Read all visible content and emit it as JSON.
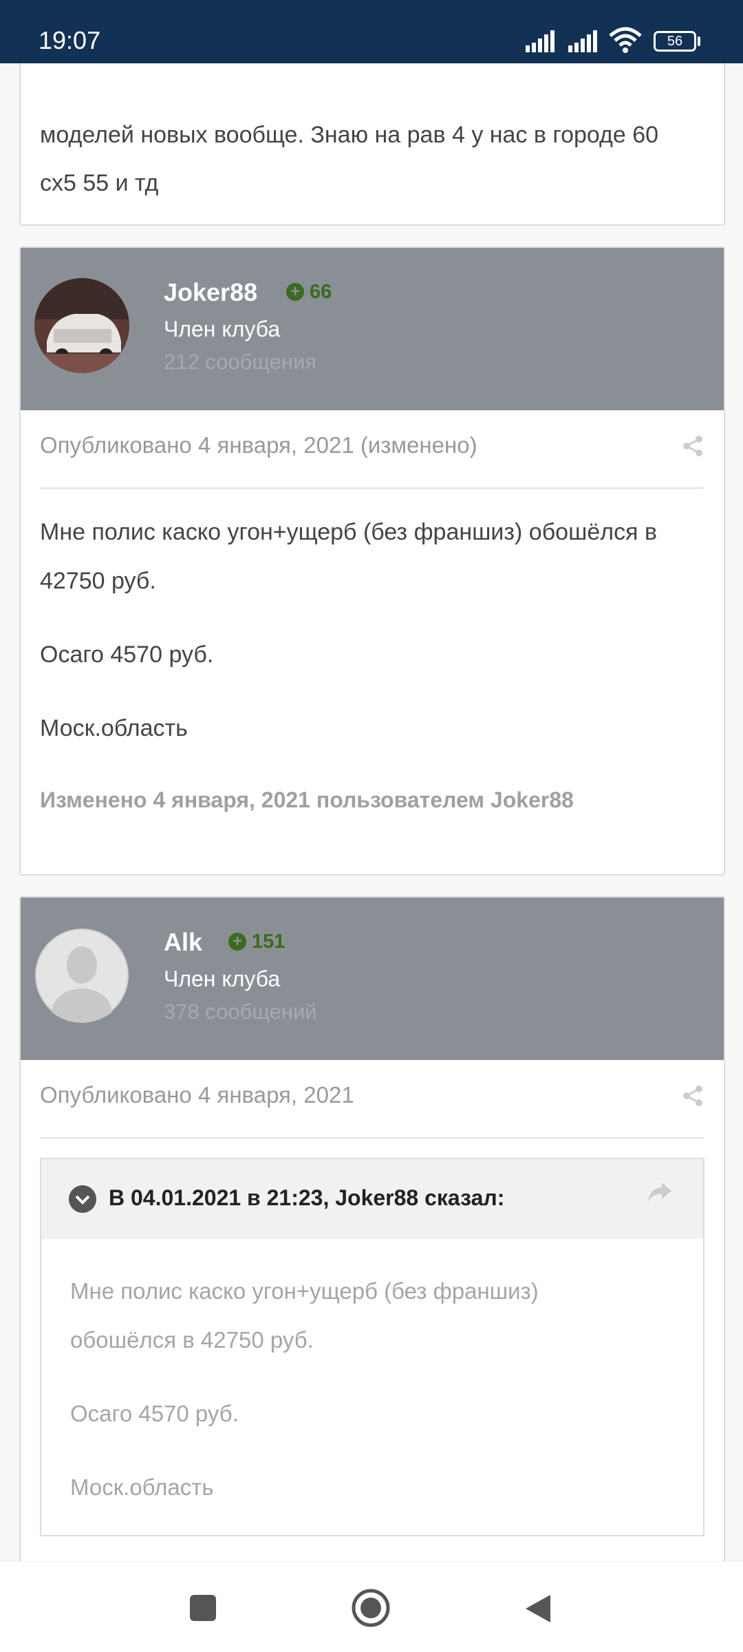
{
  "status_bar": {
    "time": "19:07",
    "battery": "56"
  },
  "prev_post": {
    "line1": "моделей новых вообще.  Знаю на рав 4 у нас в городе 60",
    "line2": "сх5 55 и тд"
  },
  "posts": [
    {
      "author": "Joker88",
      "reputation": "66",
      "role": "Член клуба",
      "post_count": "212 сообщения",
      "published": "Опубликовано 4 января, 2021 (изменено)",
      "paragraphs": [
        "Мне полис каско угон+ущерб (без франшиз) обошёлся в",
        "42750 руб.",
        "Осаго 4570 руб.",
        "Моск.область"
      ],
      "edited_note": "Изменено 4 января, 2021 пользователем Joker88"
    },
    {
      "author": "Alk",
      "reputation": "151",
      "role": "Член клуба",
      "post_count": "378 сообщений",
      "published": "Опубликовано 4 января, 2021",
      "quote": {
        "title": "В 04.01.2021 в 21:23, Joker88 сказал:",
        "lines": [
          "Мне полис каско угон+ущерб (без франшиз)",
          "обошёлся в 42750 руб.",
          "Осаго 4570 руб.",
          "Моск.область"
        ]
      }
    }
  ],
  "icons": {
    "share": "share-icon",
    "quote_toggle": "chevron-down-icon",
    "quote_jump": "forward-arrow-icon",
    "nav": [
      "recents-square-icon",
      "home-circle-icon",
      "back-triangle-icon"
    ]
  },
  "colors": {
    "status_bar": "#133155",
    "post_header": "#8a8f96",
    "reputation": "#3a6b1e"
  }
}
